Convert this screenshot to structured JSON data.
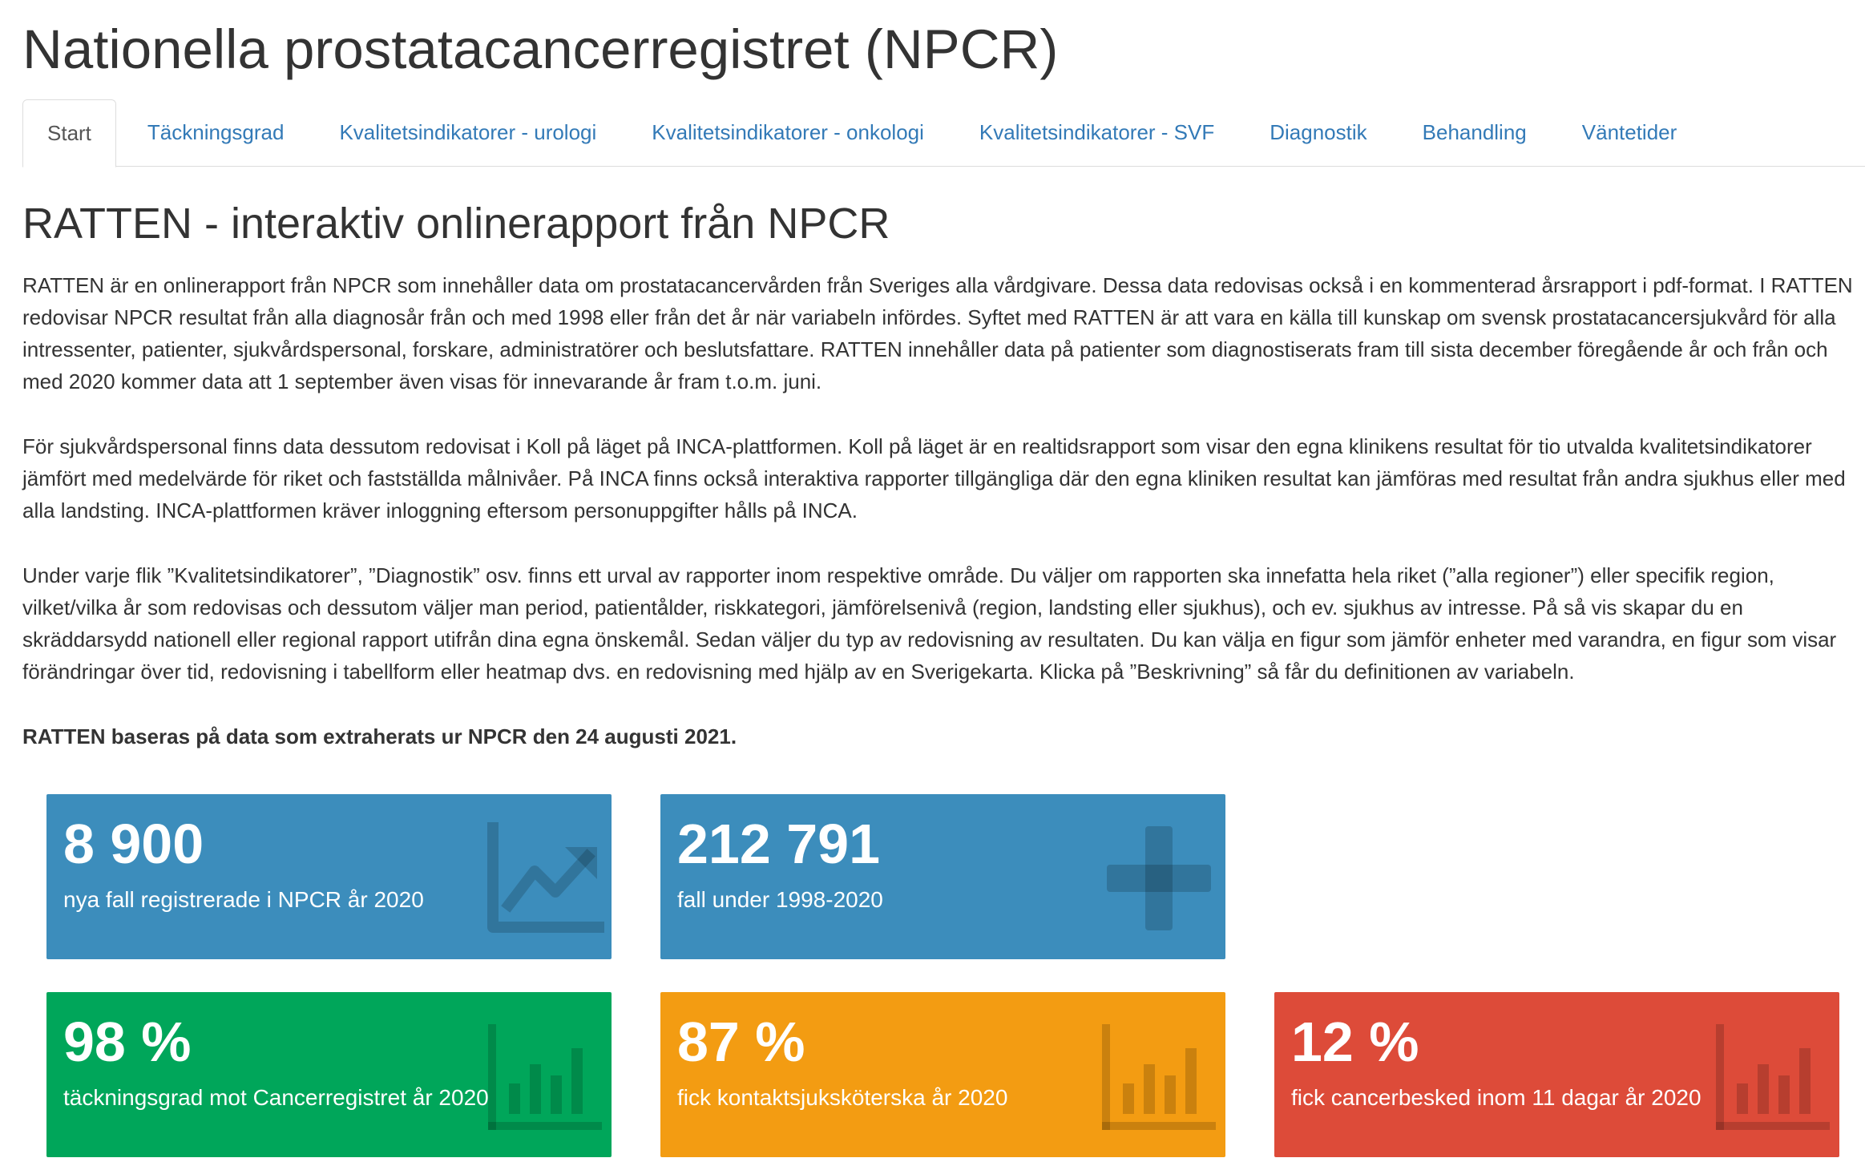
{
  "header": {
    "title": "Nationella prostatacancerregistret (NPCR)"
  },
  "tabs": [
    {
      "label": "Start",
      "active": true
    },
    {
      "label": "Täckningsgrad"
    },
    {
      "label": "Kvalitetsindikatorer - urologi"
    },
    {
      "label": "Kvalitetsindikatorer - onkologi"
    },
    {
      "label": "Kvalitetsindikatorer - SVF"
    },
    {
      "label": "Diagnostik"
    },
    {
      "label": "Behandling"
    },
    {
      "label": "Väntetider"
    }
  ],
  "main": {
    "title": "RATTEN - interaktiv onlinerapport från NPCR",
    "paragraphs": [
      "RATTEN är en onlinerapport från NPCR som innehåller data om prostatacancervården från Sveriges alla vårdgivare. Dessa data redovisas också i en kommenterad årsrapport i pdf-format. I RATTEN redovisar NPCR resultat från alla diagnosår från och med 1998 eller från det år när variabeln infördes. Syftet med RATTEN är att vara en källa till kunskap om svensk prostatacancersjukvård för alla intressenter, patienter, sjukvårdspersonal, forskare, administratörer och beslutsfattare. RATTEN innehåller data på patienter som diagnostiserats fram till sista december föregående år och från och med 2020 kommer data att 1 september även visas för innevarande år fram t.o.m. juni.",
      "För sjukvårdspersonal finns data dessutom redovisat i Koll på läget på INCA-plattformen. Koll på läget är en realtidsrapport som visar den egna klinikens resultat för tio utvalda kvalitetsindikatorer jämfört med medelvärde för riket och fastställda målnivåer. På INCA finns också interaktiva rapporter tillgängliga där den egna kliniken resultat kan jämföras med resultat från andra sjukhus eller med alla landsting. INCA-plattformen kräver inloggning eftersom personuppgifter hålls på INCA.",
      "Under varje flik ”Kvalitetsindikatorer”, ”Diagnostik” osv. finns ett urval av rapporter inom respektive område. Du väljer om rapporten ska innefatta hela riket (”alla regioner”) eller specifik region, vilket/vilka år som redovisas och dessutom väljer man period, patientålder, riskkategori, jämförelsenivå (region, landsting eller sjukhus), och ev. sjukhus av intresse. På så vis skapar du en skräddarsydd nationell eller regional rapport utifrån dina egna önskemål. Sedan väljer du typ av redovisning av resultaten. Du kan välja en figur som jämför enheter med varandra, en figur som visar förändringar över tid, redovisning i tabellform eller heatmap dvs. en redovisning med hjälp av en Sverigekarta. Klicka på ”Beskrivning” så får du definitionen av variabeln."
    ],
    "extract_note": "RATTEN baseras på data som extraherats ur NPCR den 24 augusti 2021."
  },
  "value_boxes": [
    {
      "value": "8 900",
      "label": "nya fall registrerade i NPCR år 2020",
      "color": "#3c8dbc",
      "icon": "line-chart-icon"
    },
    {
      "value": "212 791",
      "label": "fall under 1998-2020",
      "color": "#3c8dbc",
      "icon": "plus-icon"
    },
    {
      "value": "98 %",
      "label": "täckningsgrad mot Cancerregistret år 2020",
      "color": "#00a65a",
      "icon": "bar-chart-icon"
    },
    {
      "value": "87 %",
      "label": "fick kontaktsjuksköterska år 2020",
      "color": "#f39c12",
      "icon": "bar-chart-icon"
    },
    {
      "value": "12 %",
      "label": "fick cancerbesked inom 11 dagar år 2020",
      "color": "#dd4b39",
      "icon": "bar-chart-icon"
    }
  ]
}
